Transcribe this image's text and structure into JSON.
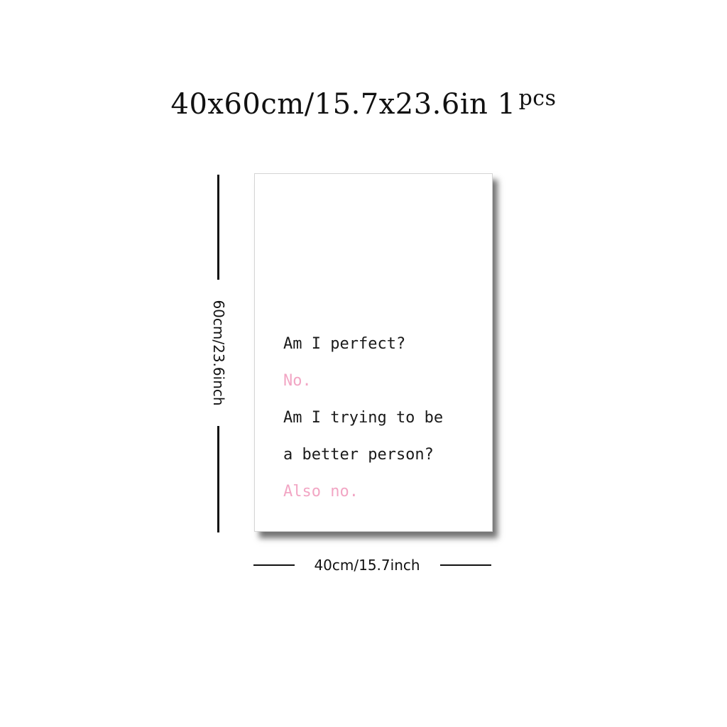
{
  "title": {
    "main": "40x60cm/15.7x23.6in 1",
    "superscript": "pcs"
  },
  "poster": {
    "lines": [
      {
        "text": "Am I perfect?",
        "color": "#1a1a1a"
      },
      {
        "text": "No.",
        "color": "#f2a6c4"
      },
      {
        "text": "Am I trying to be",
        "color": "#1a1a1a"
      },
      {
        "text": "a better person?",
        "color": "#1a1a1a"
      },
      {
        "text": "Also no.",
        "color": "#f2a6c4"
      }
    ]
  },
  "dimensions": {
    "height_label": "60cm/23.6inch",
    "width_label": "40cm/15.7inch"
  },
  "colors": {
    "accent_pink": "#f2a6c4",
    "text_dark": "#1a1a1a"
  }
}
